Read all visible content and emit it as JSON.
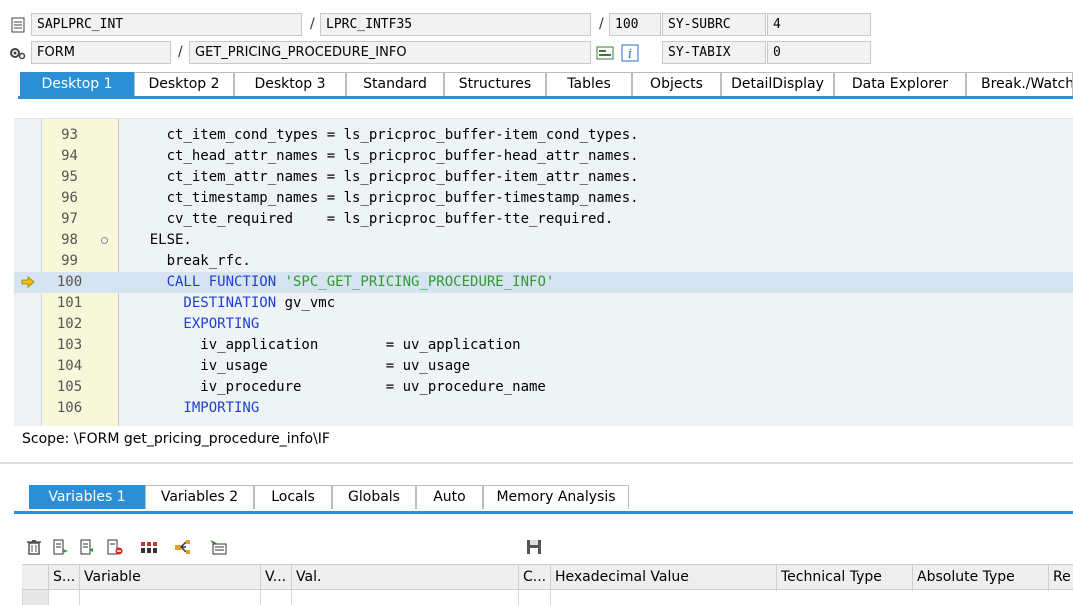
{
  "header": {
    "row1": {
      "program": "SAPLPRC_INT",
      "include": "LPRC_INTF35",
      "line": "100",
      "sysvar_label": "SY-SUBRC",
      "sysvar_value": "4"
    },
    "row2": {
      "event_type": "FORM",
      "event_name": "GET_PRICING_PROCEDURE_INFO",
      "sysvar_label": "SY-TABIX",
      "sysvar_value": "0"
    },
    "separator": "/"
  },
  "tabs": [
    "Desktop 1",
    "Desktop 2",
    "Desktop 3",
    "Standard",
    "Structures",
    "Tables",
    "Objects",
    "DetailDisplay",
    "Data Explorer",
    "Break./Watchpoints"
  ],
  "code": {
    "lines": [
      {
        "no": "93",
        "segments": [
          {
            "t": "      ct_item_cond_types = ls_pricproc_buffer-item_cond_types.",
            "c": ""
          }
        ]
      },
      {
        "no": "94",
        "segments": [
          {
            "t": "      ct_head_attr_names = ls_pricproc_buffer-head_attr_names.",
            "c": ""
          }
        ]
      },
      {
        "no": "95",
        "segments": [
          {
            "t": "      ct_item_attr_names = ls_pricproc_buffer-item_attr_names.",
            "c": ""
          }
        ]
      },
      {
        "no": "96",
        "segments": [
          {
            "t": "      ct_timestamp_names = ls_pricproc_buffer-timestamp_names.",
            "c": ""
          }
        ]
      },
      {
        "no": "97",
        "segments": [
          {
            "t": "      cv_tte_required    = ls_pricproc_buffer-tte_required.",
            "c": ""
          }
        ]
      },
      {
        "no": "98",
        "segments": [
          {
            "t": "    ELSE.",
            "c": ""
          }
        ]
      },
      {
        "no": "99",
        "segments": [
          {
            "t": "      break_rfc.",
            "c": ""
          }
        ]
      },
      {
        "no": "100",
        "segments": [
          {
            "t": "      CALL FUNCTION ",
            "c": "kw"
          },
          {
            "t": "'SPC_GET_PRICING_PROCEDURE_INFO'",
            "c": "str"
          }
        ]
      },
      {
        "no": "101",
        "segments": [
          {
            "t": "        DESTINATION ",
            "c": "kw"
          },
          {
            "t": "gv_vmc",
            "c": ""
          }
        ]
      },
      {
        "no": "102",
        "segments": [
          {
            "t": "        EXPORTING",
            "c": "kw"
          }
        ]
      },
      {
        "no": "103",
        "segments": [
          {
            "t": "          iv_application        = uv_application",
            "c": ""
          }
        ]
      },
      {
        "no": "104",
        "segments": [
          {
            "t": "          iv_usage              = uv_usage",
            "c": ""
          }
        ]
      },
      {
        "no": "105",
        "segments": [
          {
            "t": "          iv_procedure          = uv_procedure_name",
            "c": ""
          }
        ]
      },
      {
        "no": "106",
        "segments": [
          {
            "t": "        IMPORTING",
            "c": "kw"
          }
        ]
      }
    ]
  },
  "scope": "Scope: \\FORM get_pricing_procedure_info\\IF",
  "lower_tabs": [
    "Variables 1",
    "Variables 2",
    "Locals",
    "Globals",
    "Auto",
    "Memory Analysis"
  ],
  "toolbar_icons": [
    "trash-icon",
    "insert-row-icon",
    "import-row-icon",
    "delete-row-icon",
    "columns-icon",
    "navigate-icon",
    "export-icon",
    "save-icon"
  ],
  "grid": {
    "columns": [
      "S...",
      "Variable",
      "V...",
      "Val.",
      "C...",
      "Hexadecimal Value",
      "Technical Type",
      "Absolute Type",
      "Re"
    ]
  },
  "colors": {
    "accent": "#2b8fd6",
    "keyword": "#1f3fd0",
    "string": "#2f9b2f",
    "current_line": "#d6e3f0",
    "line_number_bg": "#f7f7d9"
  }
}
